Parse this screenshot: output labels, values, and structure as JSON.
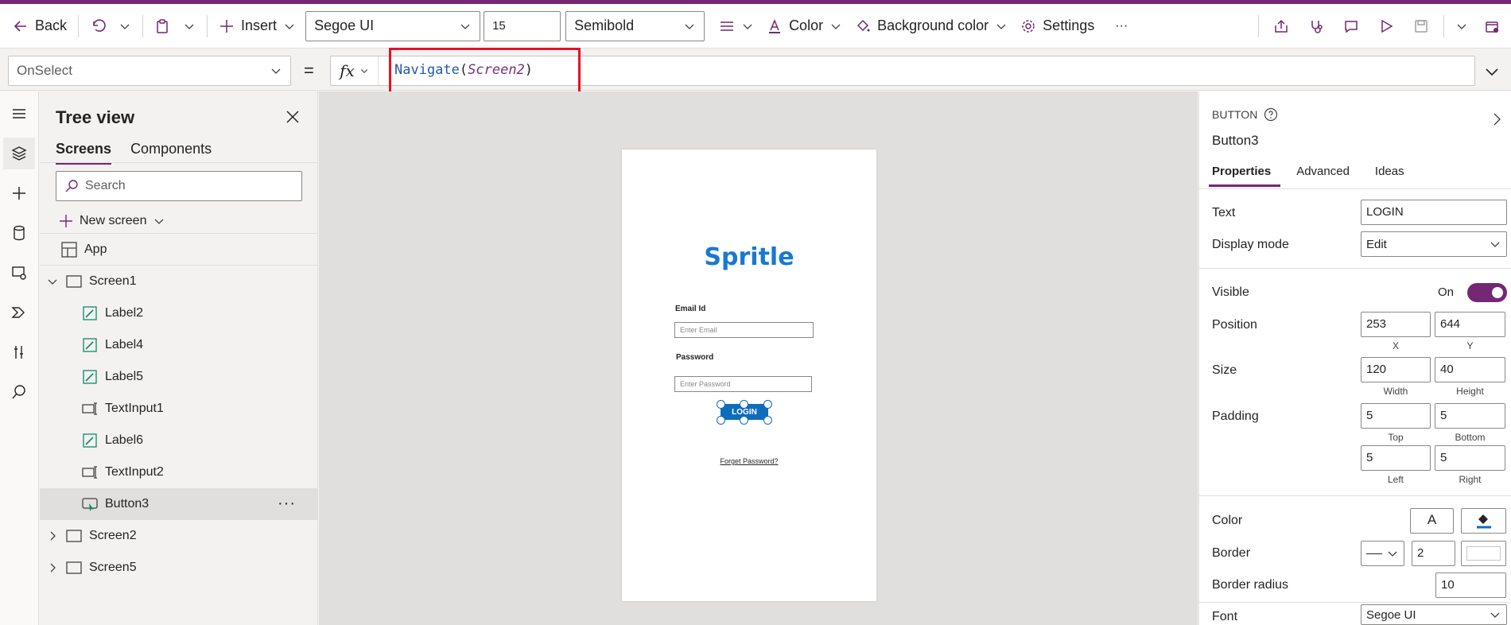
{
  "toolbar": {
    "back_label": "Back",
    "insert_label": "Insert",
    "font_family": "Segoe UI",
    "font_size": "15",
    "font_weight": "Semibold",
    "color_label": "Color",
    "background_color_label": "Background color",
    "settings_label": "Settings",
    "more_label": "···"
  },
  "formula_bar": {
    "property": "OnSelect",
    "equals": "=",
    "fx": "fx",
    "formula_fn": "Navigate",
    "formula_open": "(",
    "formula_arg": "Screen2",
    "formula_close": ")"
  },
  "tree_view": {
    "title": "Tree view",
    "tabs": [
      "Screens",
      "Components"
    ],
    "search_placeholder": "Search",
    "new_screen_label": "New screen",
    "app_label": "App",
    "screen1": "Screen1",
    "children": [
      "Label2",
      "Label4",
      "Label5",
      "TextInput1",
      "Label6",
      "TextInput2",
      "Button3"
    ],
    "more": "···",
    "screen2": "Screen2",
    "screen5": "Screen5"
  },
  "canvas": {
    "logo": "Spritle",
    "email_label": "Email Id",
    "email_placeholder": "Enter Email",
    "password_label": "Password",
    "password_placeholder": "Enter Password",
    "button_text": "LOGIN",
    "forgot_link": "Forget Password?"
  },
  "properties": {
    "control_type": "BUTTON",
    "control_name": "Button3",
    "tabs": [
      "Properties",
      "Advanced",
      "Ideas"
    ],
    "text_label": "Text",
    "text_value": "LOGIN",
    "display_mode_label": "Display mode",
    "display_mode_value": "Edit",
    "visible_label": "Visible",
    "visible_value": "On",
    "position_label": "Position",
    "position_x": "253",
    "position_y": "644",
    "x_cap": "X",
    "y_cap": "Y",
    "size_label": "Size",
    "width": "120",
    "height": "40",
    "width_cap": "Width",
    "height_cap": "Height",
    "padding_label": "Padding",
    "padding_top": "5",
    "padding_bottom": "5",
    "padding_left": "5",
    "padding_right": "5",
    "top_cap": "Top",
    "bottom_cap": "Bottom",
    "left_cap": "Left",
    "right_cap": "Right",
    "color_label": "Color",
    "color_glyph": "A",
    "border_label": "Border",
    "border_width": "2",
    "border_radius_label": "Border radius",
    "border_radius": "10",
    "font_label": "Font",
    "font_value": "Segoe UI"
  },
  "colors": {
    "accent": "#742774",
    "button_blue": "#0f6cbd",
    "highlight_red": "#e81123"
  }
}
